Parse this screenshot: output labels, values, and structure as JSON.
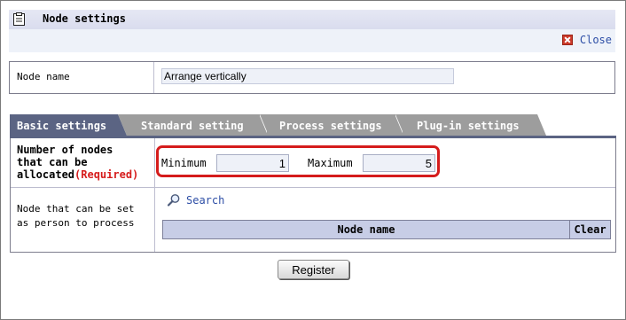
{
  "window": {
    "title": "Node settings",
    "close_label": "Close"
  },
  "node_name": {
    "label": "Node name",
    "value": "Arrange vertically"
  },
  "tabs": [
    {
      "label": "Basic settings",
      "active": true
    },
    {
      "label": "Standard setting",
      "active": false
    },
    {
      "label": "Process settings",
      "active": false
    },
    {
      "label": "Plug-in settings",
      "active": false
    }
  ],
  "allocation": {
    "label_line1": "Number of nodes",
    "label_line2": "that can be",
    "label_line3": "allocated",
    "required": "(Required)",
    "min_label": "Minimum",
    "min_value": "1",
    "max_label": "Maximum",
    "max_value": "5"
  },
  "process_person": {
    "label_line1": "Node that can be set",
    "label_line2": "as person to process",
    "search_label": "Search",
    "table_header_name": "Node name",
    "table_header_clear": "Clear"
  },
  "footer": {
    "register_label": "Register"
  },
  "colors": {
    "active_tab": "#5b6483",
    "inactive_tab": "#9d9d9d",
    "required": "#d61d1d",
    "highlight_box": "#d51c1c",
    "link": "#2d4ea6"
  }
}
